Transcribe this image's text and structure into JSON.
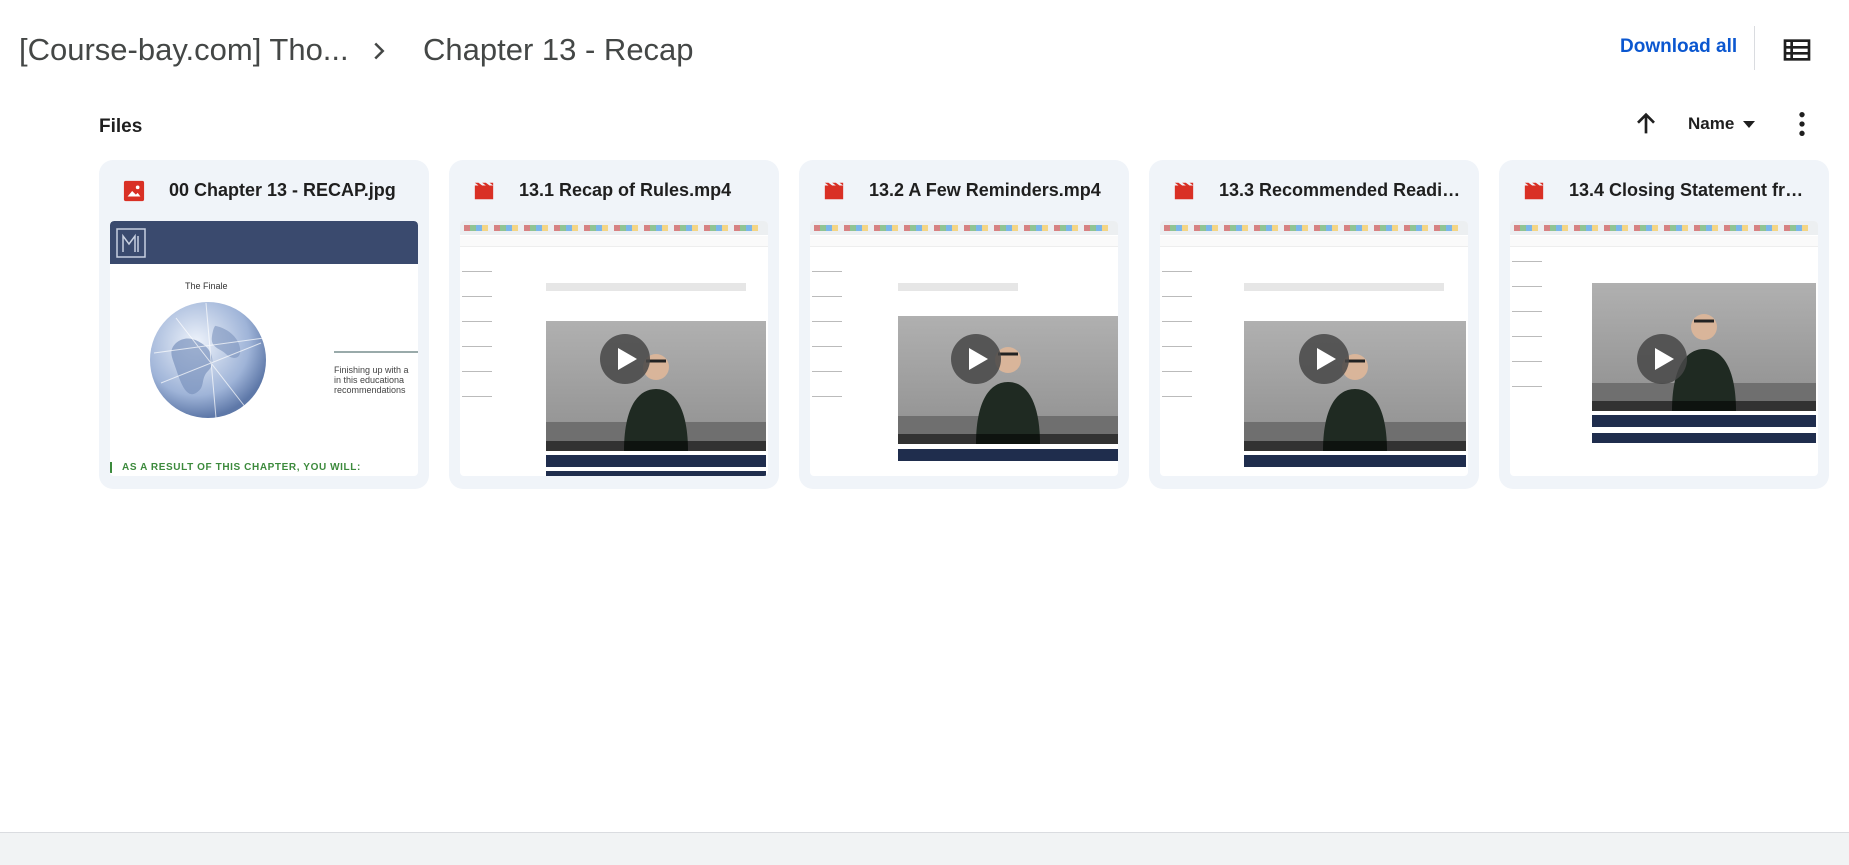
{
  "breadcrumb": {
    "root": "[Course-bay.com] Tho...",
    "current": "Chapter 13 - Recap"
  },
  "header": {
    "download_all": "Download all"
  },
  "files_section": {
    "label": "Files",
    "sort_field": "Name"
  },
  "files": [
    {
      "name": "00 Chapter 13 - RECAP.jpg",
      "type": "image"
    },
    {
      "name": "13.1 Recap of Rules.mp4",
      "type": "video"
    },
    {
      "name": "13.2 A Few Reminders.mp4",
      "type": "video"
    },
    {
      "name": "13.3 Recommended Readin...",
      "type": "video"
    },
    {
      "name": "13.4 Closing Statement from...",
      "type": "video"
    }
  ],
  "recap_thumbnail": {
    "heading": "The Finale",
    "side_text": "Finishing up with a in this educationa recommendations",
    "result_text": "AS A RESULT OF THIS CHAPTER, YOU WILL:"
  },
  "colors": {
    "image_icon": "#d93025",
    "video_icon": "#d93025",
    "link": "#0b57d0",
    "card_bg": "#f0f4f9"
  }
}
